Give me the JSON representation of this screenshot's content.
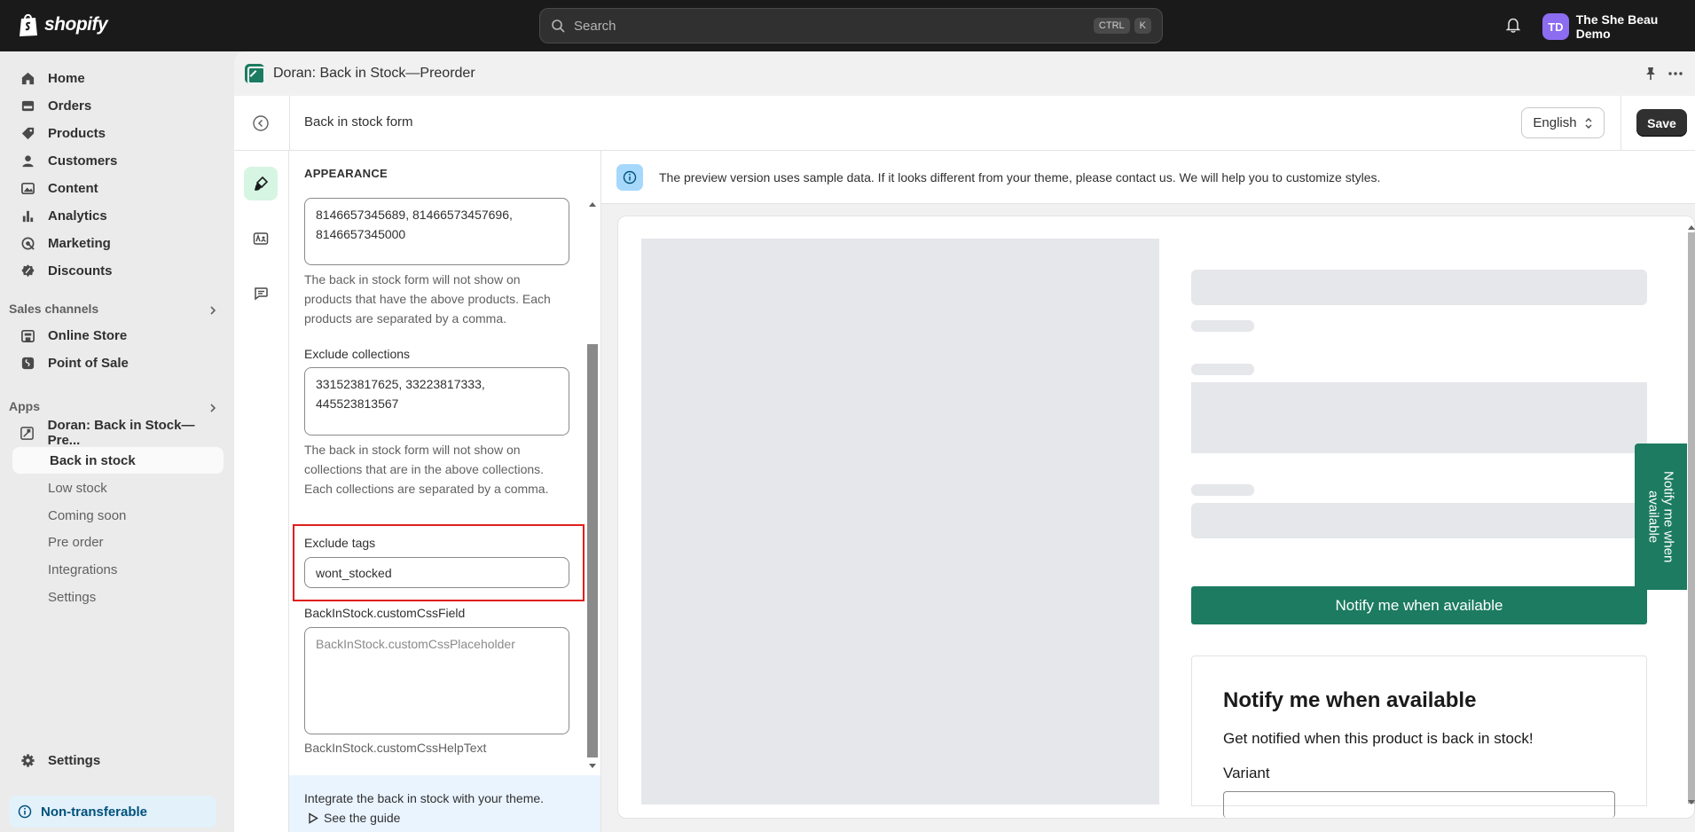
{
  "topbar": {
    "brand": "shopify",
    "search_placeholder": "Search",
    "shortcut_keys": [
      "CTRL",
      "K"
    ],
    "account_initials": "TD",
    "account_name": "The She Beau Demo"
  },
  "sidebar": {
    "main_items": [
      {
        "label": "Home",
        "icon": "home-icon"
      },
      {
        "label": "Orders",
        "icon": "orders-icon"
      },
      {
        "label": "Products",
        "icon": "products-icon"
      },
      {
        "label": "Customers",
        "icon": "customers-icon"
      },
      {
        "label": "Content",
        "icon": "content-icon"
      },
      {
        "label": "Analytics",
        "icon": "analytics-icon"
      },
      {
        "label": "Marketing",
        "icon": "marketing-icon"
      },
      {
        "label": "Discounts",
        "icon": "discounts-icon"
      }
    ],
    "sales_channels_label": "Sales channels",
    "sales_channels": [
      {
        "label": "Online Store",
        "icon": "store-icon"
      },
      {
        "label": "Point of Sale",
        "icon": "pos-icon"
      }
    ],
    "apps_label": "Apps",
    "app_name": "Doran: Back in Stock—Pre...",
    "app_sub_items": [
      "Back in stock",
      "Low stock",
      "Coming soon",
      "Pre order",
      "Integrations",
      "Settings"
    ],
    "active_sub_item": "Back in stock",
    "settings_label": "Settings",
    "non_transferable_label": "Non-transferable"
  },
  "app": {
    "title": "Doran: Back in Stock—Preorder"
  },
  "editor": {
    "title": "Back in stock form",
    "language": "English",
    "save_label": "Save"
  },
  "panel": {
    "section_title": "APPEARANCE",
    "exclude_products_value": "8146657345689, 81466573457696, 8146657345000",
    "exclude_products_help": "The back in stock form will not show on products that have the above products. Each products are separated by a comma.",
    "exclude_collections_label": "Exclude collections",
    "exclude_collections_value": "331523817625, 33223817333, 445523813567",
    "exclude_collections_help": "The back in stock form will not show on collections that are in the above collections. Each collections are separated by a comma.",
    "exclude_tags_label": "Exclude tags",
    "exclude_tags_value": "wont_stocked",
    "custom_css_label": "BackInStock.customCssField",
    "custom_css_placeholder": "BackInStock.customCssPlaceholder",
    "custom_css_help": "BackInStock.customCssHelpText",
    "guide_text": "Integrate the back in stock with your theme.",
    "guide_link": "See the guide"
  },
  "preview": {
    "banner_text": "The preview version uses sample data. If it looks different from your theme, please contact us. We will help you to customize styles.",
    "notify_button": "Notify me when available",
    "side_tab": "Notify me when available",
    "form_heading": "Notify me when available",
    "form_subtitle": "Get notified when this product is back in stock!",
    "variant_label": "Variant"
  },
  "colors": {
    "accent_green": "#1c7b61",
    "highlight_red": "#e01e1e",
    "topbar_bg": "#1a1a1a"
  }
}
